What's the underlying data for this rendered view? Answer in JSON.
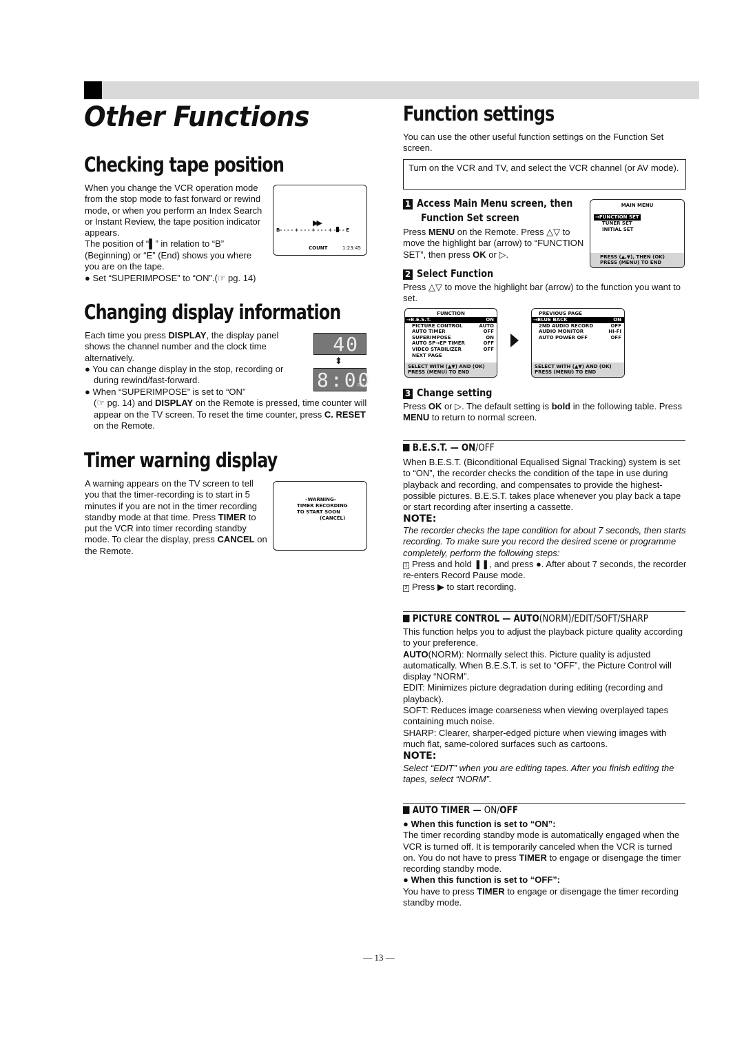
{
  "header": {
    "title": "Other Functions"
  },
  "tape_position": {
    "heading": "Checking tape position",
    "body": "When you change the VCR operation mode from the stop mode to fast forward or rewind mode, or when you perform an Index Search or Instant Review, the tape position indicator appears.",
    "body2_pre": "The position of “",
    "body2_marker": "▌",
    "body2_post": "” in relation to “B” (Beginning) or “E” (End) shows you where you are on the tape.",
    "bullet": "Set “SUPERIMPOSE” to “ON”.(☞ pg. 14)",
    "screen": {
      "ff_symbol": "▶▶",
      "scale_begin": "B",
      "scale_line": "- - - - + - - - + - - - + -",
      "scale_end": "- - E",
      "count_label": "COUNT",
      "count_value": "1:23:45"
    }
  },
  "display_info": {
    "heading": "Changing display information",
    "body_pre": "Each time you press ",
    "body_key": "DISPLAY",
    "body_post": ", the display panel shows the channel number and the clock time alternatively.",
    "bullet1": "You can change display in the stop, recording or during rewind/fast-forward.",
    "bullet2_line1": "When “SUPERIMPOSE” is set to “ON”",
    "bullet2_pre": "(☞ pg. 14) and ",
    "bullet2_key": "DISPLAY",
    "bullet2_mid": " on the Remote is pressed, time counter will appear on the TV screen. To reset the time counter, press ",
    "bullet2_key2": "C. RESET",
    "bullet2_post": " on the Remote.",
    "lcd_channel": "40",
    "lcd_time": "8:00",
    "lcd_ampm": "PM"
  },
  "timer_warning": {
    "heading": "Timer warning display",
    "body_pre": "A warning appears on the TV screen to tell you that the timer-recording is to start in 5 minutes if you are not in the timer recording standby mode at that time. Press ",
    "key1": "TIMER",
    "body_mid": " to put the VCR into timer recording standby mode. To clear the display, press ",
    "key2": "CANCEL",
    "body_post": " on the Remote.",
    "screen": {
      "line1": "–WARNING–",
      "line2": "TIMER RECORDING",
      "line3": "TO START SOON",
      "line4": "(CANCEL)"
    }
  },
  "function_settings": {
    "heading": "Function settings",
    "intro": "You can use the other useful function settings on the Function Set screen.",
    "boxed_note": "Turn on the VCR and TV, and select the VCR channel (or AV mode).",
    "steps": [
      {
        "number": "1",
        "title": "Access Main Menu screen, then Function Set screen",
        "title_line1": "Access Main Menu screen, then",
        "title_line2": "Function Set screen",
        "body_pre": "Press ",
        "key1": "MENU",
        "body_mid": " on the Remote. Press △▽ to move the highlight bar (arrow) to “FUNCTION SET”, then press ",
        "key2": "OK",
        "body_post": " or ▷."
      },
      {
        "number": "2",
        "title": "Select Function",
        "body": "Press △▽ to move the highlight bar (arrow) to the function you want to set."
      },
      {
        "number": "3",
        "title": "Change setting",
        "body_pre": "Press ",
        "key1": "OK",
        "body_mid": " or ▷. The default setting is ",
        "key2": "bold",
        "body_mid2": " in the following table. Press ",
        "key3": "MENU",
        "body_post": " to return to normal screen."
      }
    ],
    "main_menu_screen": {
      "title": "MAIN MENU",
      "items": [
        "→FUNCTION SET",
        "TUNER SET",
        "INITIAL SET"
      ],
      "footer1": "PRESS (▲,▼), THEN (OK)",
      "footer2": "PRESS (MENU) TO END"
    },
    "function_screen": {
      "title": "FUNCTION",
      "rows": [
        {
          "label": "→B.E.S.T.",
          "value": "ON"
        },
        {
          "label": "PICTURE CONTROL",
          "value": "AUTO"
        },
        {
          "label": "AUTO TIMER",
          "value": "OFF"
        },
        {
          "label": "SUPERIMPOSE",
          "value": "ON"
        },
        {
          "label": "AUTO SP→EP TIMER",
          "value": "OFF"
        },
        {
          "label": "VIDEO STABILIZER",
          "value": "OFF"
        },
        {
          "label": "NEXT PAGE",
          "value": ""
        }
      ],
      "footer1": "SELECT WITH (▲▼) AND (OK)",
      "footer2": "PRESS (MENU) TO END"
    },
    "function_screen2": {
      "title": "PREVIOUS PAGE",
      "rows": [
        {
          "label": "→BLUE BACK",
          "value": "ON"
        },
        {
          "label": "2ND AUDIO RECORD",
          "value": "OFF"
        },
        {
          "label": "AUDIO MONITOR",
          "value": "HI-FI"
        },
        {
          "label": "AUTO POWER OFF",
          "value": "OFF"
        }
      ],
      "footer1": "SELECT WITH (▲▼) AND (OK)",
      "footer2": "PRESS (MENU) TO END"
    }
  },
  "best": {
    "heading_bold": "B.E.S.T. — ON",
    "heading_rest": "/OFF",
    "body": "When B.E.S.T. (Biconditional Equalised Signal Tracking) system is set to “ON”, the recorder checks the condition of the tape in use during playback and recording, and compensates to provide the highest-possible pictures. B.E.S.T. takes place whenever you play back a tape or start recording after inserting a cassette.",
    "note_label": "NOTE:",
    "note": "The recorder checks the tape condition for about 7 seconds, then starts recording. To make sure you record the desired scene or programme completely, perform the following steps:",
    "step1_num": "1",
    "step1": "Press and hold ❚❚, and press ●. After about 7 seconds, the recorder re-enters Record Pause mode.",
    "step2_num": "2",
    "step2": "Press ▶ to start recording."
  },
  "picture_control": {
    "heading_bold": "PICTURE CONTROL — AUTO",
    "heading_rest": "(NORM)/EDIT/SOFT/SHARP",
    "intro": "This function helps you to adjust the playback picture quality according to your preference.",
    "auto_label": "AUTO",
    "auto_text": "(NORM): Normally select this. Picture quality is adjusted automatically. When B.E.S.T. is set to “OFF”, the Picture Control will display “NORM”.",
    "edit": "EDIT: Minimizes picture degradation during editing (recording and playback).",
    "soft": "SOFT: Reduces image coarseness when viewing overplayed tapes containing much noise.",
    "sharp": "SHARP: Clearer, sharper-edged picture when viewing images with much flat, same-colored surfaces such as cartoons.",
    "note_label": "NOTE:",
    "note": "Select “EDIT” when you are editing tapes. After you finish editing the tapes, select “NORM”."
  },
  "auto_timer": {
    "heading_bold": "AUTO TIMER — ",
    "heading_mid": "ON/",
    "heading_end": "OFF",
    "on_label": "When this function is set to “ON”:",
    "on_pre": "The timer recording standby mode is automatically engaged when the VCR is turned off. It is temporarily canceled when the VCR is turned on. You do not have to press ",
    "on_key": "TIMER",
    "on_post": " to engage or disengage the timer recording standby mode.",
    "off_label": "When this function is set to “OFF”:",
    "off_pre": "You have to press ",
    "off_key": "TIMER",
    "off_post": " to engage or disengage the timer recording standby mode."
  },
  "footer": {
    "page_number": "— 13 —"
  }
}
